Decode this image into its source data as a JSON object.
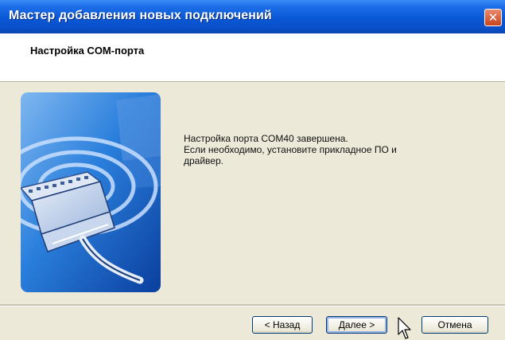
{
  "window": {
    "title": "Мастер добавления новых подключений",
    "close_glyph": "✕"
  },
  "header": {
    "title": "Настройка COM-порта"
  },
  "message": {
    "line1": "Настройка порта COM40 завершена.",
    "line2": "Если необходимо, установите прикладное ПО и",
    "line3": "драйвер."
  },
  "buttons": {
    "back": "< Назад",
    "next": "Далее >",
    "cancel": "Отмена"
  },
  "icons": {
    "wizard_bitmap": "wireless-connection-illustration",
    "cursor": "mouse-pointer-icon"
  },
  "colors": {
    "titlebar": "#0a58d6",
    "dialog_bg": "#ECE9D8",
    "header_bg": "#ffffff",
    "bitmap_blue": "#1b6fd3"
  }
}
